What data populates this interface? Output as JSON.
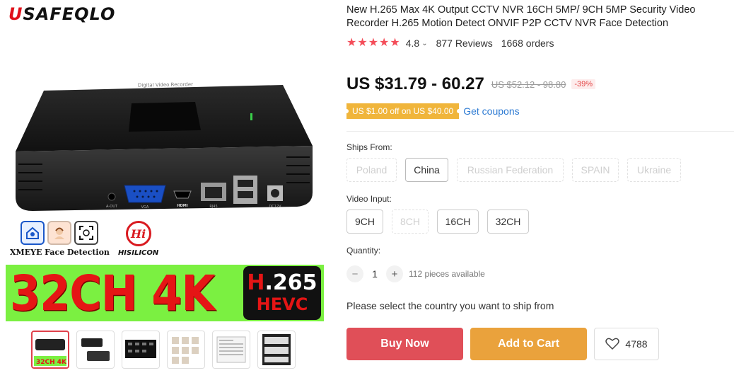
{
  "gallery": {
    "brand_logo_prefix": "U",
    "brand_logo_rest": "SAFEQLO",
    "device_front_text": "Digital Video Recorder",
    "port_labels": [
      "A-OUT",
      "VGA",
      "HDMI",
      "RJ45",
      "DC12V"
    ],
    "xmeye_label": "XMEYE Face Detection",
    "hisilicon_label": "HISILICON",
    "hisilicon_mark": "Hi",
    "promo_text": "32CH 4K",
    "codec_top_h": "H",
    "codec_top_rest": ".265",
    "codec_bottom": "HEVC",
    "thumbnails_count": 6,
    "active_thumbnail": 0,
    "thumb1_text": "32CH 4K"
  },
  "product": {
    "title": "New H.265 Max 4K Output CCTV NVR 16CH 5MP/ 9CH 5MP Security Video Recorder H.265 Motion Detect ONVIF P2P CCTV NVR Face Detection",
    "rating": "4.8",
    "star_count": 5,
    "reviews": "877 Reviews",
    "orders": "1668 orders",
    "price": "US $31.79 - 60.27",
    "old_price": "US $52.12 - 98.80",
    "discount": "-39%",
    "coupon_badge": "US $1.00 off on US $40.00",
    "coupon_link": "Get coupons"
  },
  "ships_from": {
    "label": "Ships From:",
    "options": [
      {
        "label": "Poland",
        "state": "disabled"
      },
      {
        "label": "China",
        "state": "selected"
      },
      {
        "label": "Russian Federation",
        "state": "disabled"
      },
      {
        "label": "SPAIN",
        "state": "disabled"
      },
      {
        "label": "Ukraine",
        "state": "disabled"
      }
    ]
  },
  "video_input": {
    "label": "Video Input:",
    "options": [
      {
        "label": "9CH",
        "state": "normal"
      },
      {
        "label": "8CH",
        "state": "disabled"
      },
      {
        "label": "16CH",
        "state": "normal"
      },
      {
        "label": "32CH",
        "state": "normal"
      }
    ]
  },
  "quantity": {
    "label": "Quantity:",
    "minus": "−",
    "value": "1",
    "plus": "+",
    "available": "112 pieces available"
  },
  "ship_note": "Please select the country you want to ship from",
  "actions": {
    "buy_now": "Buy Now",
    "add_to_cart": "Add to Cart",
    "wishlist_count": "4788"
  },
  "colors": {
    "star": "#f44d59",
    "buy": "#e04f58",
    "cart": "#eaa23c",
    "coupon": "#f0b53b",
    "link": "#2e7bd3",
    "promo_green": "#7bf041",
    "promo_red": "#e51515"
  }
}
